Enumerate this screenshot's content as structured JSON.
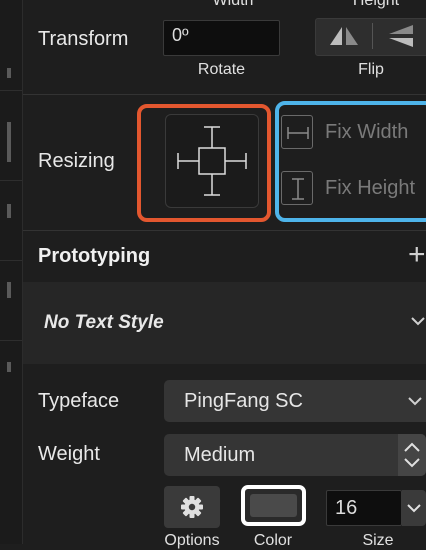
{
  "top_labels": {
    "width": "Width",
    "height": "Height"
  },
  "transform": {
    "label": "Transform",
    "rotate_value": "0º",
    "rotate_label": "Rotate",
    "flip_label": "Flip"
  },
  "resizing": {
    "label": "Resizing",
    "fix_width": "Fix Width",
    "fix_height": "Fix Height"
  },
  "prototyping": {
    "title": "Prototyping",
    "add_glyph": "+"
  },
  "text_style": {
    "value": "No Text Style"
  },
  "typeface": {
    "label": "Typeface",
    "value": "PingFang SC"
  },
  "weight": {
    "label": "Weight",
    "value": "Medium"
  },
  "text_options": {
    "options_label": "Options",
    "color_label": "Color",
    "size_label": "Size",
    "size_value": "16"
  },
  "colors": {
    "highlight_red": "#e3572f",
    "highlight_blue": "#4eb4ea",
    "text_color_swatch": "#4a4a4a"
  }
}
